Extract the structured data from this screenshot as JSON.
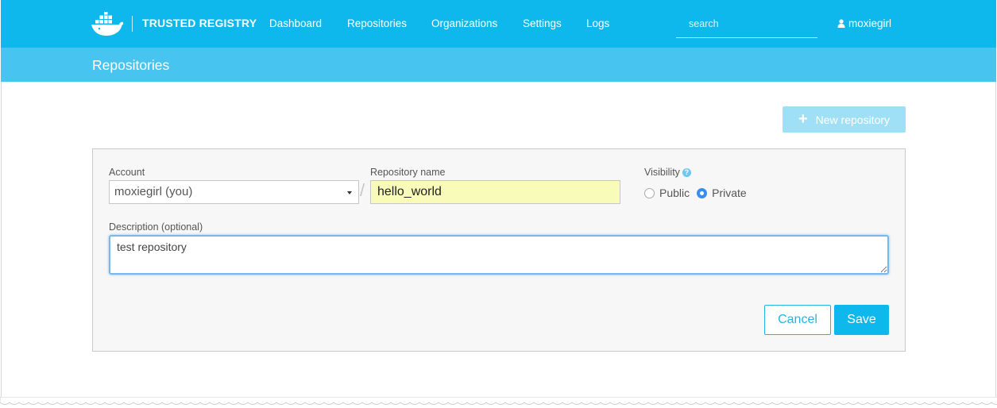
{
  "nav": {
    "brand": "TRUSTED REGISTRY",
    "links": [
      "Dashboard",
      "Repositories",
      "Organizations",
      "Settings",
      "Logs"
    ],
    "search_placeholder": "search",
    "user": "moxiegirl",
    "colors": {
      "primary": "#0fb8ec",
      "subheader": "#47c4f0"
    }
  },
  "page": {
    "title": "Repositories",
    "new_repo_label": "New repository"
  },
  "form": {
    "account_label": "Account",
    "account_value": "moxiegirl (you)",
    "separator": "/",
    "repo_name_label": "Repository name",
    "repo_name_value": "hello_world",
    "visibility_label": "Visibility",
    "visibility_help": "?",
    "visibility_options": [
      "Public",
      "Private"
    ],
    "visibility_selected": "Private",
    "description_label": "Description (optional)",
    "description_value": "test repository",
    "cancel_label": "Cancel",
    "save_label": "Save"
  },
  "icons": {
    "logo": "docker-whale-icon",
    "user": "user-icon",
    "plus": "plus-icon",
    "caret": "caret-down-icon",
    "help": "help-icon"
  }
}
